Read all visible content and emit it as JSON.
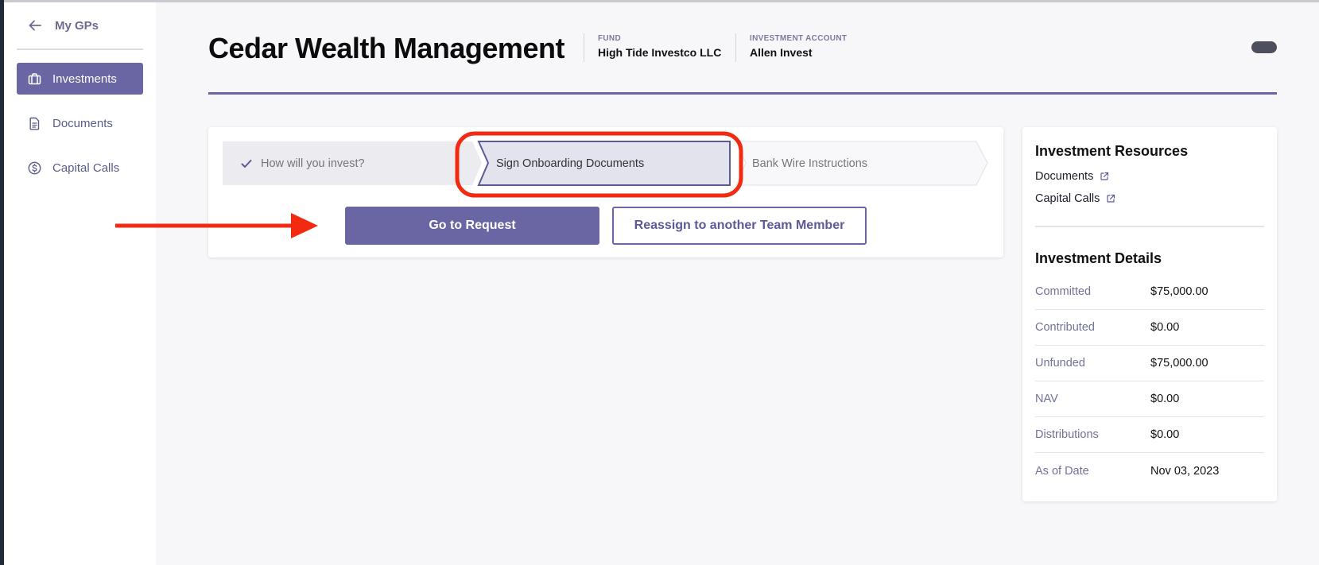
{
  "sidebar": {
    "back_label": "My GPs",
    "items": [
      {
        "label": "Investments",
        "icon": "briefcase-icon",
        "active": true
      },
      {
        "label": "Documents",
        "icon": "document-icon",
        "active": false
      },
      {
        "label": "Capital Calls",
        "icon": "dollar-circle-icon",
        "active": false
      }
    ]
  },
  "header": {
    "title": "Cedar Wealth Management",
    "fund_label": "FUND",
    "fund_value": "High Tide Investco LLC",
    "account_label": "INVESTMENT ACCOUNT",
    "account_value": "Allen Invest"
  },
  "steps": [
    {
      "label": "How will you invest?",
      "state": "completed"
    },
    {
      "label": "Sign Onboarding Documents",
      "state": "current"
    },
    {
      "label": "Bank Wire Instructions",
      "state": "upcoming"
    }
  ],
  "actions": {
    "primary_label": "Go to Request",
    "secondary_label": "Reassign to another Team Member"
  },
  "resources": {
    "title": "Investment Resources",
    "links": [
      {
        "label": "Documents"
      },
      {
        "label": "Capital Calls"
      }
    ]
  },
  "details": {
    "title": "Investment Details",
    "rows": [
      {
        "label": "Committed",
        "value": "$75,000.00"
      },
      {
        "label": "Contributed",
        "value": "$0.00"
      },
      {
        "label": "Unfunded",
        "value": "$75,000.00"
      },
      {
        "label": "NAV",
        "value": "$0.00"
      },
      {
        "label": "Distributions",
        "value": "$0.00"
      },
      {
        "label": "As of Date",
        "value": "Nov 03, 2023"
      }
    ]
  },
  "colors": {
    "accent": "#6a66a3",
    "annotation": "#f22a12"
  }
}
